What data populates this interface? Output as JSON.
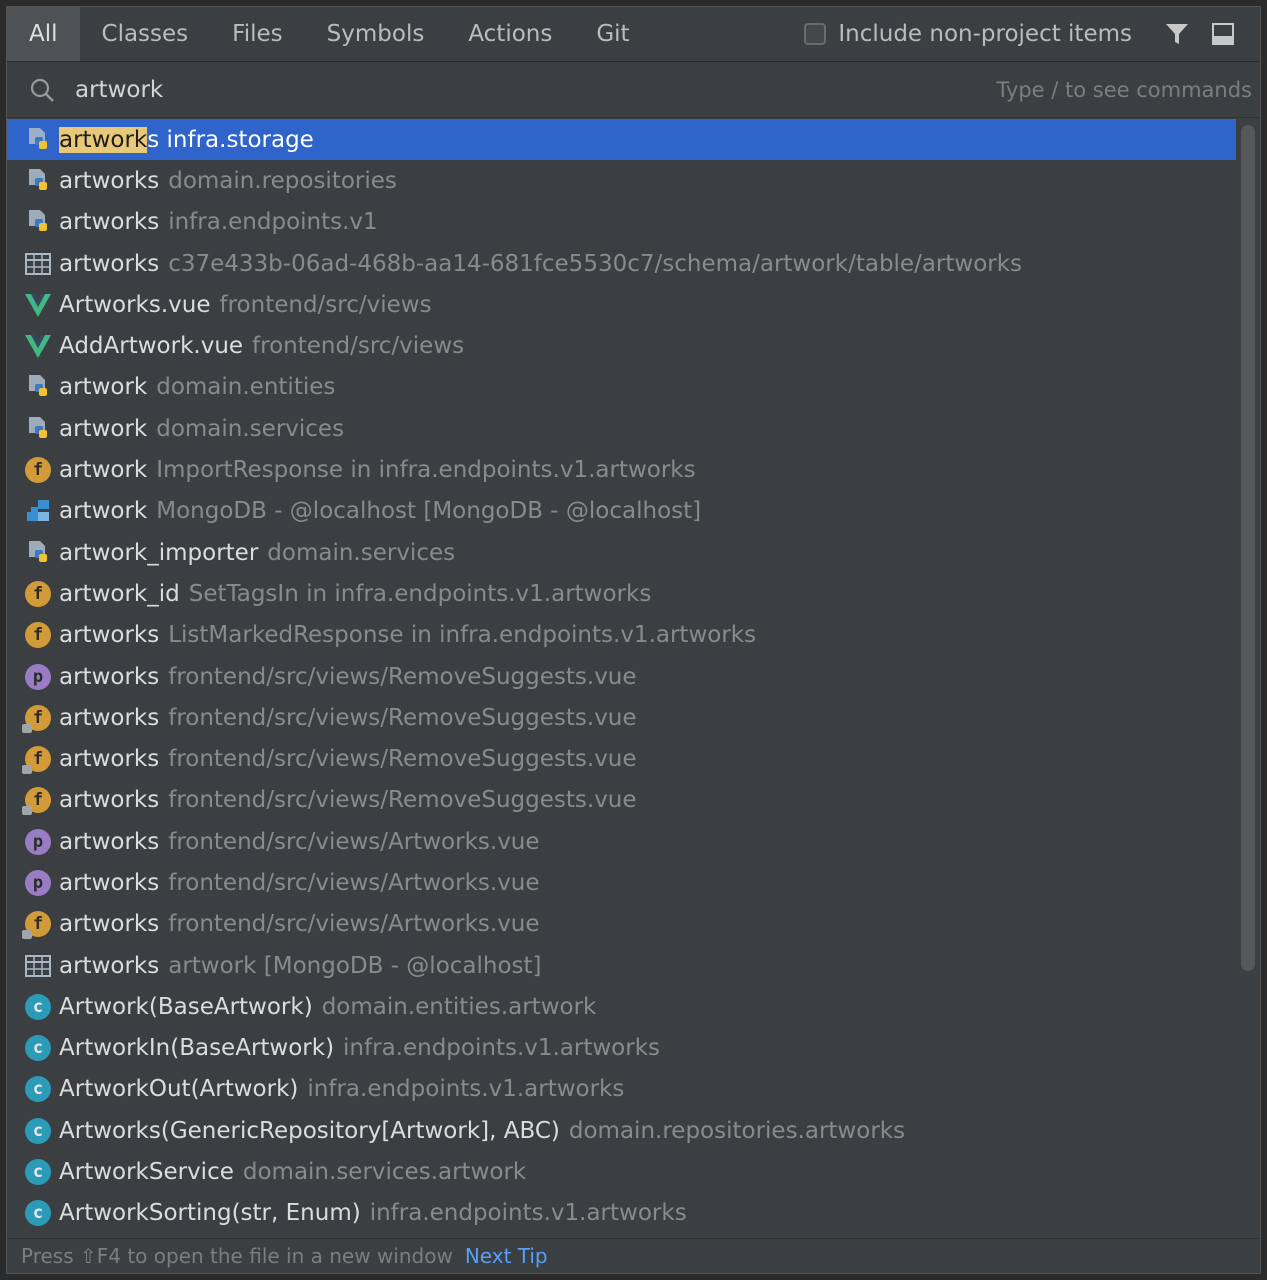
{
  "tabs": [
    {
      "label": "All",
      "active": true
    },
    {
      "label": "Classes",
      "active": false
    },
    {
      "label": "Files",
      "active": false
    },
    {
      "label": "Symbols",
      "active": false
    },
    {
      "label": "Actions",
      "active": false
    },
    {
      "label": "Git",
      "active": false
    }
  ],
  "include_label": "Include non-project items",
  "search": {
    "value": "artwork",
    "hint": "Type / to see commands"
  },
  "selected_row": {
    "highlight": "artwork",
    "rest": "s infra.storage"
  },
  "rows": [
    {
      "icon": "python-file-icon",
      "name": "artworks",
      "loc": "domain.repositories"
    },
    {
      "icon": "python-file-icon",
      "name": "artworks",
      "loc": "infra.endpoints.v1"
    },
    {
      "icon": "table-icon",
      "name": "artworks",
      "loc": "c37e433b-06ad-468b-aa14-681fce5530c7/schema/artwork/table/artworks"
    },
    {
      "icon": "vue-icon",
      "name": "Artworks.vue",
      "loc": "frontend/src/views"
    },
    {
      "icon": "vue-icon",
      "name": "AddArtwork.vue",
      "loc": "frontend/src/views"
    },
    {
      "icon": "python-file-icon",
      "name": "artwork",
      "loc": "domain.entities"
    },
    {
      "icon": "python-file-icon",
      "name": "artwork",
      "loc": "domain.services"
    },
    {
      "icon": "field-icon",
      "name": "artwork",
      "loc": "ImportResponse in infra.endpoints.v1.artworks"
    },
    {
      "icon": "database-icon",
      "name": "artwork",
      "loc": "MongoDB - @localhost [MongoDB - @localhost]"
    },
    {
      "icon": "python-file-icon",
      "name": "artwork_importer",
      "loc": "domain.services"
    },
    {
      "icon": "field-icon",
      "name": "artwork_id",
      "loc": "SetTagsIn in infra.endpoints.v1.artworks"
    },
    {
      "icon": "field-icon",
      "name": "artworks",
      "loc": "ListMarkedResponse in infra.endpoints.v1.artworks"
    },
    {
      "icon": "property-icon",
      "name": "artworks",
      "loc": "frontend/src/views/RemoveSuggests.vue"
    },
    {
      "icon": "field-locked-icon",
      "name": "artworks",
      "loc": "frontend/src/views/RemoveSuggests.vue"
    },
    {
      "icon": "field-locked-icon",
      "name": "artworks",
      "loc": "frontend/src/views/RemoveSuggests.vue"
    },
    {
      "icon": "field-locked-icon",
      "name": "artworks",
      "loc": "frontend/src/views/RemoveSuggests.vue"
    },
    {
      "icon": "property-icon",
      "name": "artworks",
      "loc": "frontend/src/views/Artworks.vue"
    },
    {
      "icon": "property-icon",
      "name": "artworks",
      "loc": "frontend/src/views/Artworks.vue"
    },
    {
      "icon": "field-locked-icon",
      "name": "artworks",
      "loc": "frontend/src/views/Artworks.vue"
    },
    {
      "icon": "table-icon",
      "name": "artworks",
      "loc": "artwork [MongoDB - @localhost]"
    },
    {
      "icon": "class-icon",
      "name": "Artwork(BaseArtwork)",
      "loc": "domain.entities.artwork"
    },
    {
      "icon": "class-icon",
      "name": "ArtworkIn(BaseArtwork)",
      "loc": "infra.endpoints.v1.artworks"
    },
    {
      "icon": "class-icon",
      "name": "ArtworkOut(Artwork)",
      "loc": "infra.endpoints.v1.artworks"
    },
    {
      "icon": "class-icon",
      "name": "Artworks(GenericRepository[Artwork], ABC)",
      "loc": "domain.repositories.artworks"
    },
    {
      "icon": "class-icon",
      "name": "ArtworkService",
      "loc": "domain.services.artwork"
    },
    {
      "icon": "class-icon",
      "name": "ArtworkSorting(str, Enum)",
      "loc": "infra.endpoints.v1.artworks"
    }
  ],
  "status": {
    "tip": "Press ⇧F4 to open the file in a new window",
    "next": "Next Tip"
  },
  "colors": {
    "selection": "#2f65ca",
    "highlight": "#e8c978",
    "link": "#589df6"
  }
}
